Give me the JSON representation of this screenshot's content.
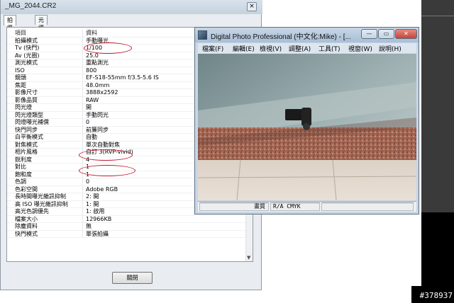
{
  "properties_window": {
    "title": "_MG_2044.CR2",
    "close_glyph": "×",
    "tabs": [
      "拍攝資訊",
      "元資料"
    ],
    "header": {
      "item": "項目",
      "value": "資料"
    },
    "rows": [
      {
        "k": "拍攝模式",
        "v": "手動曝光"
      },
      {
        "k": "Tv (快門)",
        "v": "1/100"
      },
      {
        "k": "Av (光圈)",
        "v": "25.0"
      },
      {
        "k": "測光模式",
        "v": "重點測光"
      },
      {
        "k": "ISO",
        "v": "800"
      },
      {
        "k": "鏡頭",
        "v": "EF-S18-55mm f/3.5-5.6 IS"
      },
      {
        "k": "焦距",
        "v": "48.0mm"
      },
      {
        "k": "影像尺寸",
        "v": "3888x2592"
      },
      {
        "k": "影像品質",
        "v": "RAW"
      },
      {
        "k": "閃光燈",
        "v": "開"
      },
      {
        "k": "閃光燈類型",
        "v": "手動閃光"
      },
      {
        "k": "閃燈曝光補償",
        "v": "0"
      },
      {
        "k": "快門同步",
        "v": "前簾同步"
      },
      {
        "k": "白平衡模式",
        "v": "自動"
      },
      {
        "k": "對焦模式",
        "v": "單次自動對焦"
      },
      {
        "k": "相片風格",
        "v": "自訂 3(RVP-vivid)"
      },
      {
        "k": "銳利度",
        "v": "4"
      },
      {
        "k": "對比",
        "v": "1"
      },
      {
        "k": "飽和度",
        "v": "1"
      },
      {
        "k": "色調",
        "v": "0"
      },
      {
        "k": "色彩空間",
        "v": "Adobe RGB"
      },
      {
        "k": "長時間曝光雜訊抑制",
        "v": "2: 開"
      },
      {
        "k": "高 ISO 曝光雜訊抑制",
        "v": "1: 開"
      },
      {
        "k": "高光色調優先",
        "v": "1: 啟用"
      },
      {
        "k": "檔案大小",
        "v": "12966KB"
      },
      {
        "k": "除塵資料",
        "v": "無"
      },
      {
        "k": "快門模式",
        "v": "單張拍攝"
      }
    ],
    "close_button": "關閉"
  },
  "dpp_window": {
    "title": "Digital Photo Professional (中文化:Mike) - [...",
    "buttons": {
      "minimize": "—",
      "maximize": "▭",
      "close": "✕"
    },
    "menu": [
      "檔案(F)",
      "編輯(E)",
      "檢視(V)",
      "調整(A)",
      "工具(T)",
      "視窗(W)",
      "說明(H)"
    ],
    "status": [
      "畫質",
      "R/A CMYK",
      ""
    ]
  },
  "watermark": "#378937",
  "colors": {
    "highlight_ellipse": "#c0172b",
    "titlebar": "#c7d6e6"
  }
}
